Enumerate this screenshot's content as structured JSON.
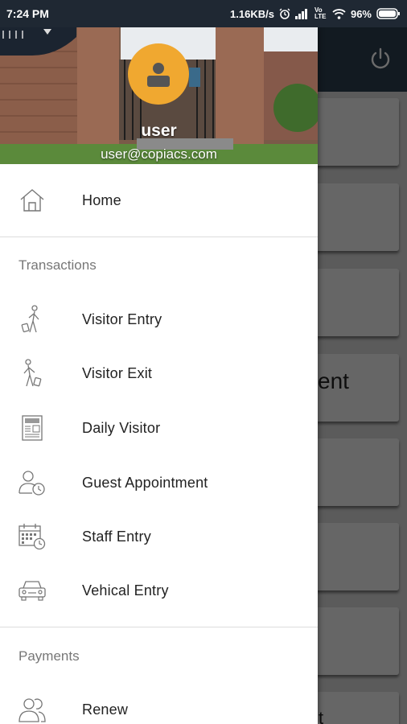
{
  "status_bar": {
    "time": "7:24 PM",
    "network_speed": "1.16KB/s",
    "battery": "96%",
    "volte": "Vo LTE",
    "icons": [
      "alarm-icon",
      "signal-icon",
      "wifi-icon",
      "battery-icon"
    ]
  },
  "drawer": {
    "user_name": "user",
    "user_email": "user@copiacs.com",
    "home_label": "Home",
    "sections": [
      {
        "title": "Transactions",
        "items": [
          {
            "label": "Visitor Entry",
            "icon": "visitor-entry-icon"
          },
          {
            "label": "Visitor Exit",
            "icon": "visitor-exit-icon"
          },
          {
            "label": "Daily Visitor",
            "icon": "newspaper-icon"
          },
          {
            "label": "Guest Appointment",
            "icon": "user-clock-icon"
          },
          {
            "label": "Staff Entry",
            "icon": "calendar-clock-icon"
          },
          {
            "label": "Vehical Entry",
            "icon": "car-icon"
          }
        ]
      },
      {
        "title": "Payments",
        "items": [
          {
            "label": "Renew",
            "icon": "users-icon"
          }
        ]
      }
    ]
  },
  "background": {
    "partial_text_1": "ent",
    "partial_text_2": "t"
  },
  "colors": {
    "status_bar": "#1f2833",
    "avatar": "#f0a830",
    "app_bar": "#2c3e50",
    "section_title": "#777777"
  }
}
